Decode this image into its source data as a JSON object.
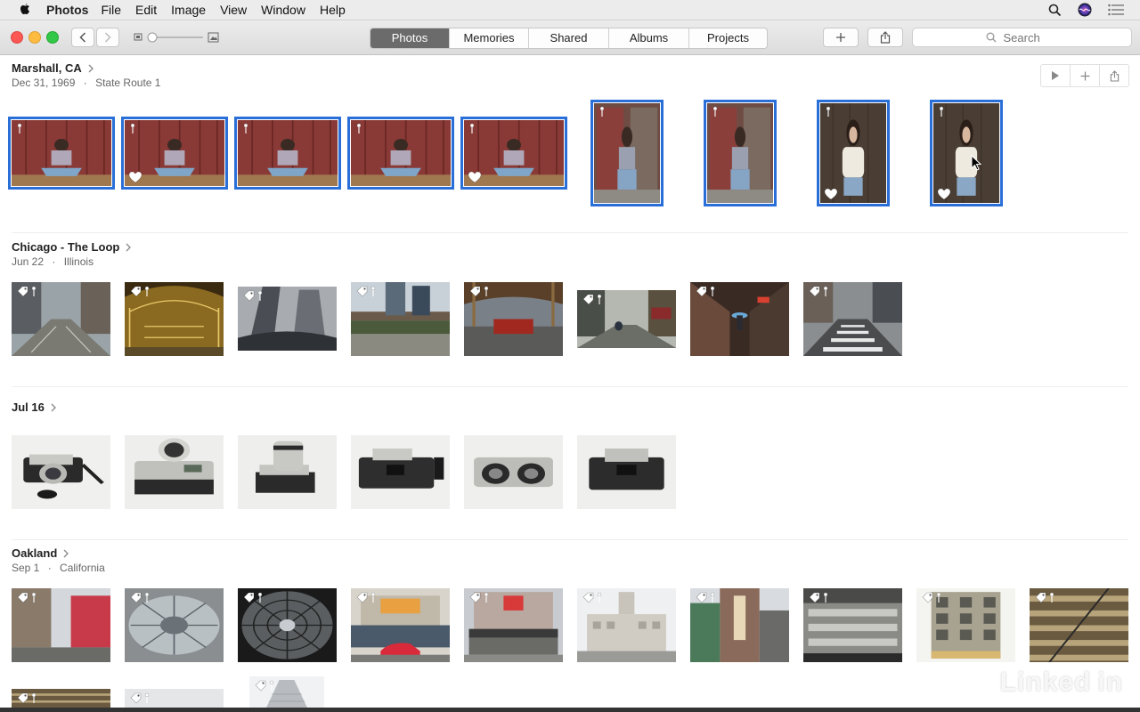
{
  "menubar": {
    "app_name": "Photos",
    "items": [
      "File",
      "Edit",
      "Image",
      "View",
      "Window",
      "Help"
    ]
  },
  "toolbar": {
    "tabs": [
      {
        "label": "Photos",
        "active": true
      },
      {
        "label": "Memories",
        "active": false
      },
      {
        "label": "Shared",
        "active": false
      },
      {
        "label": "Albums",
        "active": false
      },
      {
        "label": "Projects",
        "active": false
      }
    ],
    "search_placeholder": "Search"
  },
  "moments": [
    {
      "title": "Marshall, CA",
      "date": "Dec 31, 1969",
      "location": "State Route 1"
    },
    {
      "title": "Chicago - The Loop",
      "date": "Jun 22",
      "location": "Illinois"
    },
    {
      "title": "Jul 16",
      "date": "",
      "location": ""
    },
    {
      "title": "Oakland",
      "date": "Sep 1",
      "location": "California"
    }
  ],
  "separator": "·",
  "watermark": {
    "brand": "Linked",
    "suffix": "in"
  },
  "colors": {
    "selection": "#2a6fd8",
    "active_tab": "#6b6b6b"
  },
  "icons": [
    "apple-icon",
    "search-icon",
    "siri-icon",
    "list-icon",
    "chevron-left-icon",
    "chevron-right-icon",
    "plus-icon",
    "share-icon",
    "play-icon",
    "heart-icon",
    "tag-icon",
    "pin-icon"
  ]
}
